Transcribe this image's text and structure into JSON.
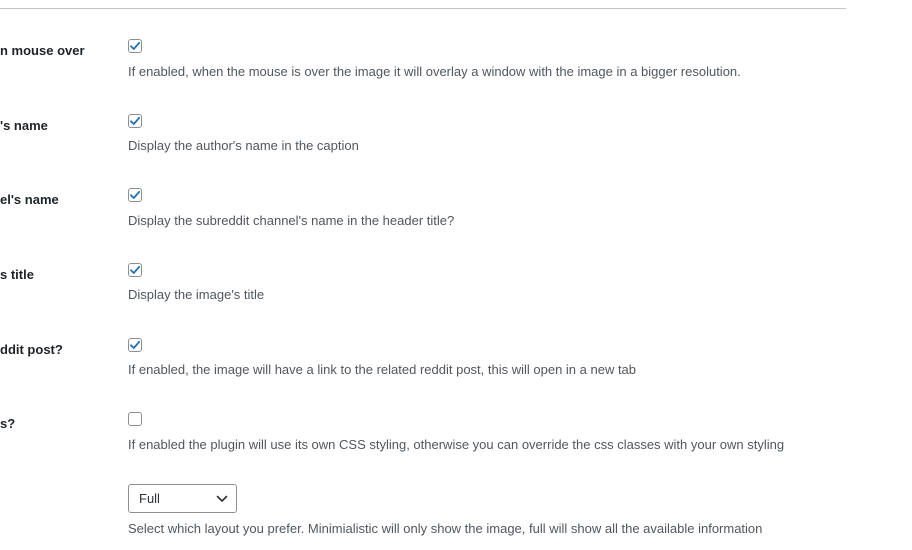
{
  "settings": {
    "rows": [
      {
        "label": "n mouse over",
        "checked": true,
        "description": "If enabled, when the mouse is over the image it will overlay a window with the image in a bigger resolution."
      },
      {
        "label": "'s name",
        "checked": true,
        "description": "Display the author's name in the caption"
      },
      {
        "label": "el's name",
        "checked": true,
        "description": "Display the subreddit channel's name in the header title?"
      },
      {
        "label": "s title",
        "checked": true,
        "description": "Display the image's title"
      },
      {
        "label": "ddit post?",
        "checked": true,
        "description": "If enabled, the image will have a link to the related reddit post, this will open in a new tab"
      },
      {
        "label": "s?",
        "checked": false,
        "description": "If enabled the plugin will use its own CSS styling, otherwise you can override the css classes with your own styling"
      }
    ],
    "layout": {
      "selected": "Full",
      "description": "Select which layout you prefer. Minimialistic will only show the image, full will show all the available information"
    }
  },
  "icons": {
    "check": "check-icon",
    "chevron": "chevron-down-icon"
  },
  "colors": {
    "check": "#2271b1",
    "border": "#8c8f94",
    "text": "#1d2327",
    "description": "#50575e"
  }
}
